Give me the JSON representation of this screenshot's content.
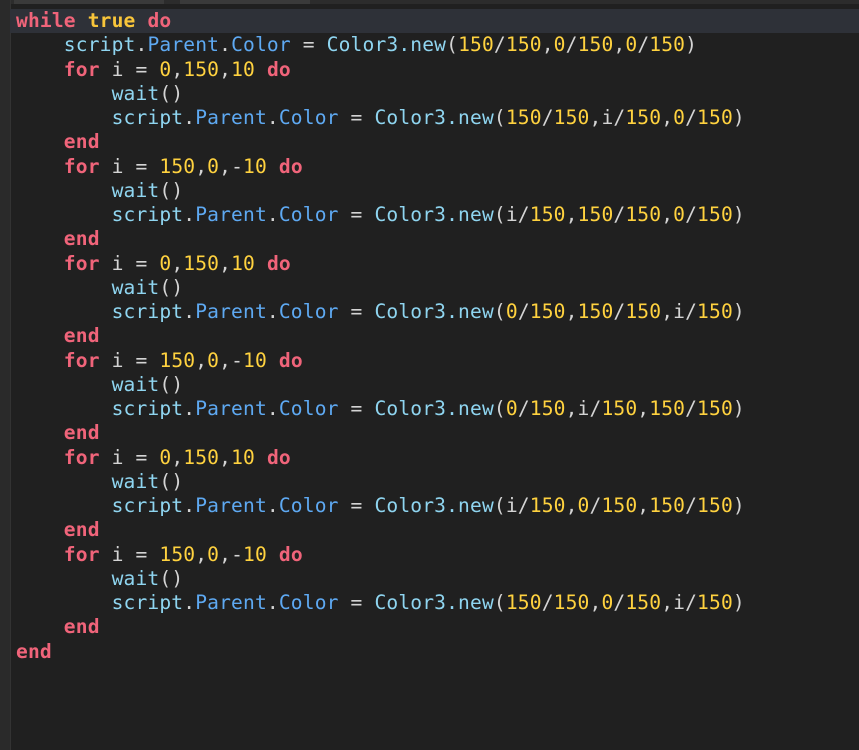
{
  "editor": {
    "lines": [
      {
        "indent": 0,
        "active": true,
        "tokens": [
          [
            "kw",
            "while"
          ],
          [
            "plain",
            " "
          ],
          [
            "kw-y",
            "true"
          ],
          [
            "plain",
            " "
          ],
          [
            "kw",
            "do"
          ]
        ]
      },
      {
        "indent": 1,
        "tokens": [
          [
            "id",
            "script"
          ],
          [
            "plain",
            "."
          ],
          [
            "prop",
            "Parent"
          ],
          [
            "plain",
            "."
          ],
          [
            "prop",
            "Color"
          ],
          [
            "plain",
            " = "
          ],
          [
            "fn",
            "Color3.new"
          ],
          [
            "plain",
            "("
          ],
          [
            "num",
            "150"
          ],
          [
            "plain",
            "/"
          ],
          [
            "num",
            "150"
          ],
          [
            "plain",
            ","
          ],
          [
            "num",
            "0"
          ],
          [
            "plain",
            "/"
          ],
          [
            "num",
            "150"
          ],
          [
            "plain",
            ","
          ],
          [
            "num",
            "0"
          ],
          [
            "plain",
            "/"
          ],
          [
            "num",
            "150"
          ],
          [
            "plain",
            ")"
          ]
        ]
      },
      {
        "indent": 1,
        "tokens": [
          [
            "kw",
            "for"
          ],
          [
            "plain",
            " i = "
          ],
          [
            "num",
            "0"
          ],
          [
            "plain",
            ","
          ],
          [
            "num",
            "150"
          ],
          [
            "plain",
            ","
          ],
          [
            "num",
            "10"
          ],
          [
            "plain",
            " "
          ],
          [
            "kw",
            "do"
          ]
        ]
      },
      {
        "indent": 2,
        "tokens": [
          [
            "fn",
            "wait"
          ],
          [
            "plain",
            "()"
          ]
        ]
      },
      {
        "indent": 2,
        "tokens": [
          [
            "id",
            "script"
          ],
          [
            "plain",
            "."
          ],
          [
            "prop",
            "Parent"
          ],
          [
            "plain",
            "."
          ],
          [
            "prop",
            "Color"
          ],
          [
            "plain",
            " = "
          ],
          [
            "fn",
            "Color3.new"
          ],
          [
            "plain",
            "("
          ],
          [
            "num",
            "150"
          ],
          [
            "plain",
            "/"
          ],
          [
            "num",
            "150"
          ],
          [
            "plain",
            ",i/"
          ],
          [
            "num",
            "150"
          ],
          [
            "plain",
            ","
          ],
          [
            "num",
            "0"
          ],
          [
            "plain",
            "/"
          ],
          [
            "num",
            "150"
          ],
          [
            "plain",
            ")"
          ]
        ]
      },
      {
        "indent": 1,
        "tokens": [
          [
            "kw",
            "end"
          ]
        ]
      },
      {
        "indent": 1,
        "tokens": [
          [
            "kw",
            "for"
          ],
          [
            "plain",
            " i = "
          ],
          [
            "num",
            "150"
          ],
          [
            "plain",
            ","
          ],
          [
            "num",
            "0"
          ],
          [
            "plain",
            ",-"
          ],
          [
            "num",
            "10"
          ],
          [
            "plain",
            " "
          ],
          [
            "kw",
            "do"
          ]
        ]
      },
      {
        "indent": 2,
        "tokens": [
          [
            "fn",
            "wait"
          ],
          [
            "plain",
            "()"
          ]
        ]
      },
      {
        "indent": 2,
        "tokens": [
          [
            "id",
            "script"
          ],
          [
            "plain",
            "."
          ],
          [
            "prop",
            "Parent"
          ],
          [
            "plain",
            "."
          ],
          [
            "prop",
            "Color"
          ],
          [
            "plain",
            " = "
          ],
          [
            "fn",
            "Color3.new"
          ],
          [
            "plain",
            "(i/"
          ],
          [
            "num",
            "150"
          ],
          [
            "plain",
            ","
          ],
          [
            "num",
            "150"
          ],
          [
            "plain",
            "/"
          ],
          [
            "num",
            "150"
          ],
          [
            "plain",
            ","
          ],
          [
            "num",
            "0"
          ],
          [
            "plain",
            "/"
          ],
          [
            "num",
            "150"
          ],
          [
            "plain",
            ")"
          ]
        ]
      },
      {
        "indent": 1,
        "tokens": [
          [
            "kw",
            "end"
          ]
        ]
      },
      {
        "indent": 1,
        "tokens": [
          [
            "kw",
            "for"
          ],
          [
            "plain",
            " i = "
          ],
          [
            "num",
            "0"
          ],
          [
            "plain",
            ","
          ],
          [
            "num",
            "150"
          ],
          [
            "plain",
            ","
          ],
          [
            "num",
            "10"
          ],
          [
            "plain",
            " "
          ],
          [
            "kw",
            "do"
          ]
        ]
      },
      {
        "indent": 2,
        "tokens": [
          [
            "fn",
            "wait"
          ],
          [
            "plain",
            "()"
          ]
        ]
      },
      {
        "indent": 2,
        "tokens": [
          [
            "id",
            "script"
          ],
          [
            "plain",
            "."
          ],
          [
            "prop",
            "Parent"
          ],
          [
            "plain",
            "."
          ],
          [
            "prop",
            "Color"
          ],
          [
            "plain",
            " = "
          ],
          [
            "fn",
            "Color3.new"
          ],
          [
            "plain",
            "("
          ],
          [
            "num",
            "0"
          ],
          [
            "plain",
            "/"
          ],
          [
            "num",
            "150"
          ],
          [
            "plain",
            ","
          ],
          [
            "num",
            "150"
          ],
          [
            "plain",
            "/"
          ],
          [
            "num",
            "150"
          ],
          [
            "plain",
            ",i/"
          ],
          [
            "num",
            "150"
          ],
          [
            "plain",
            ")"
          ]
        ]
      },
      {
        "indent": 1,
        "tokens": [
          [
            "kw",
            "end"
          ]
        ]
      },
      {
        "indent": 1,
        "tokens": [
          [
            "kw",
            "for"
          ],
          [
            "plain",
            " i = "
          ],
          [
            "num",
            "150"
          ],
          [
            "plain",
            ","
          ],
          [
            "num",
            "0"
          ],
          [
            "plain",
            ",-"
          ],
          [
            "num",
            "10"
          ],
          [
            "plain",
            " "
          ],
          [
            "kw",
            "do"
          ]
        ]
      },
      {
        "indent": 2,
        "tokens": [
          [
            "fn",
            "wait"
          ],
          [
            "plain",
            "()"
          ]
        ]
      },
      {
        "indent": 2,
        "tokens": [
          [
            "id",
            "script"
          ],
          [
            "plain",
            "."
          ],
          [
            "prop",
            "Parent"
          ],
          [
            "plain",
            "."
          ],
          [
            "prop",
            "Color"
          ],
          [
            "plain",
            " = "
          ],
          [
            "fn",
            "Color3.new"
          ],
          [
            "plain",
            "("
          ],
          [
            "num",
            "0"
          ],
          [
            "plain",
            "/"
          ],
          [
            "num",
            "150"
          ],
          [
            "plain",
            ",i/"
          ],
          [
            "num",
            "150"
          ],
          [
            "plain",
            ","
          ],
          [
            "num",
            "150"
          ],
          [
            "plain",
            "/"
          ],
          [
            "num",
            "150"
          ],
          [
            "plain",
            ")"
          ]
        ]
      },
      {
        "indent": 1,
        "tokens": [
          [
            "kw",
            "end"
          ]
        ]
      },
      {
        "indent": 1,
        "tokens": [
          [
            "kw",
            "for"
          ],
          [
            "plain",
            " i = "
          ],
          [
            "num",
            "0"
          ],
          [
            "plain",
            ","
          ],
          [
            "num",
            "150"
          ],
          [
            "plain",
            ","
          ],
          [
            "num",
            "10"
          ],
          [
            "plain",
            " "
          ],
          [
            "kw",
            "do"
          ]
        ]
      },
      {
        "indent": 2,
        "tokens": [
          [
            "fn",
            "wait"
          ],
          [
            "plain",
            "()"
          ]
        ]
      },
      {
        "indent": 2,
        "tokens": [
          [
            "id",
            "script"
          ],
          [
            "plain",
            "."
          ],
          [
            "prop",
            "Parent"
          ],
          [
            "plain",
            "."
          ],
          [
            "prop",
            "Color"
          ],
          [
            "plain",
            " = "
          ],
          [
            "fn",
            "Color3.new"
          ],
          [
            "plain",
            "(i/"
          ],
          [
            "num",
            "150"
          ],
          [
            "plain",
            ","
          ],
          [
            "num",
            "0"
          ],
          [
            "plain",
            "/"
          ],
          [
            "num",
            "150"
          ],
          [
            "plain",
            ","
          ],
          [
            "num",
            "150"
          ],
          [
            "plain",
            "/"
          ],
          [
            "num",
            "150"
          ],
          [
            "plain",
            ")"
          ]
        ]
      },
      {
        "indent": 1,
        "tokens": [
          [
            "kw",
            "end"
          ]
        ]
      },
      {
        "indent": 1,
        "tokens": [
          [
            "kw",
            "for"
          ],
          [
            "plain",
            " i = "
          ],
          [
            "num",
            "150"
          ],
          [
            "plain",
            ","
          ],
          [
            "num",
            "0"
          ],
          [
            "plain",
            ",-"
          ],
          [
            "num",
            "10"
          ],
          [
            "plain",
            " "
          ],
          [
            "kw",
            "do"
          ]
        ]
      },
      {
        "indent": 2,
        "tokens": [
          [
            "fn",
            "wait"
          ],
          [
            "plain",
            "()"
          ]
        ]
      },
      {
        "indent": 2,
        "tokens": [
          [
            "id",
            "script"
          ],
          [
            "plain",
            "."
          ],
          [
            "prop",
            "Parent"
          ],
          [
            "plain",
            "."
          ],
          [
            "prop",
            "Color"
          ],
          [
            "plain",
            " = "
          ],
          [
            "fn",
            "Color3.new"
          ],
          [
            "plain",
            "("
          ],
          [
            "num",
            "150"
          ],
          [
            "plain",
            "/"
          ],
          [
            "num",
            "150"
          ],
          [
            "plain",
            ","
          ],
          [
            "num",
            "0"
          ],
          [
            "plain",
            "/"
          ],
          [
            "num",
            "150"
          ],
          [
            "plain",
            ",i/"
          ],
          [
            "num",
            "150"
          ],
          [
            "plain",
            ")"
          ]
        ]
      },
      {
        "indent": 1,
        "tokens": [
          [
            "kw",
            "end"
          ]
        ]
      },
      {
        "indent": 0,
        "tokens": [
          [
            "kw",
            "end"
          ]
        ]
      }
    ]
  }
}
